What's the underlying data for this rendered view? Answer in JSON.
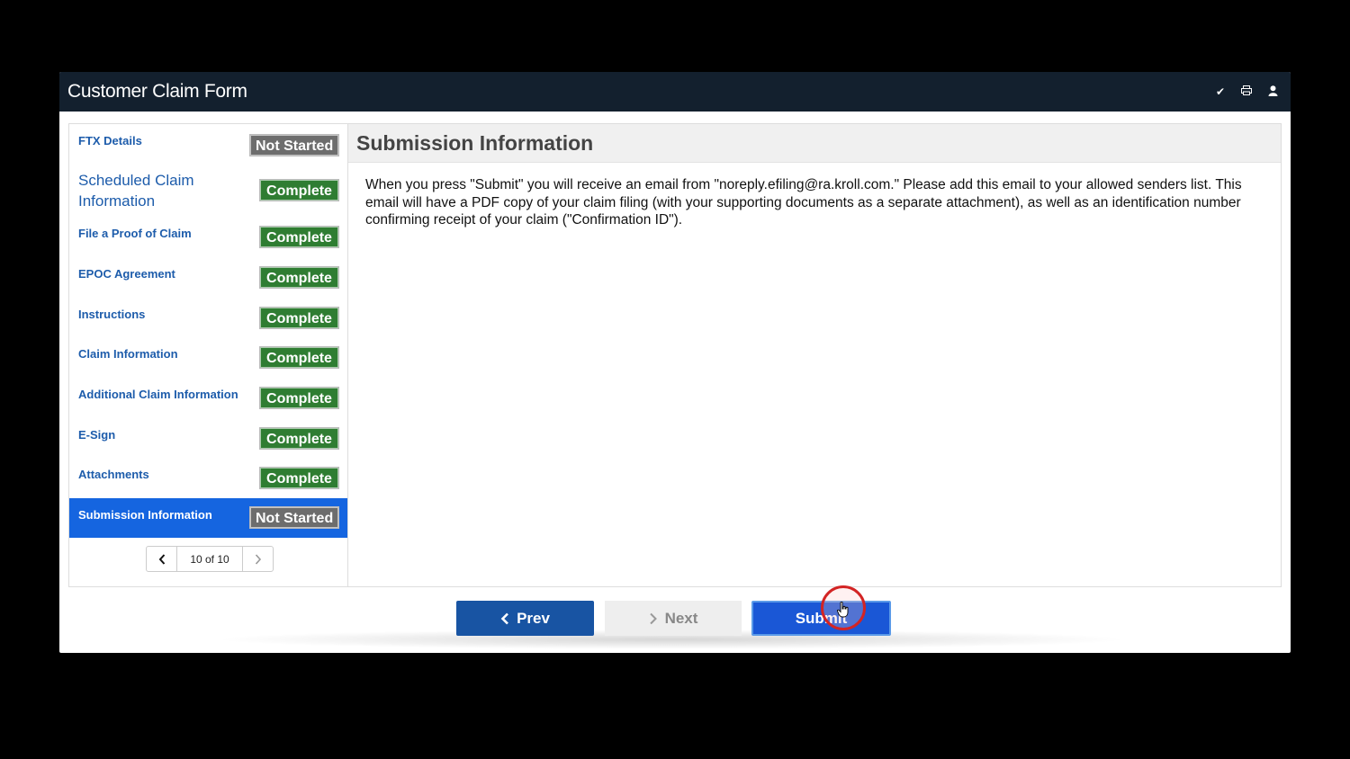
{
  "window": {
    "title": "Customer Claim Form",
    "icons": [
      "check-icon",
      "print-icon",
      "user-icon"
    ]
  },
  "sidebar": {
    "items": [
      {
        "label": "FTX Details",
        "status": "Not Started"
      },
      {
        "label": "Scheduled Claim Information",
        "status": "Complete"
      },
      {
        "label": "File a Proof of Claim",
        "status": "Complete"
      },
      {
        "label": "EPOC Agreement",
        "status": "Complete"
      },
      {
        "label": "Instructions",
        "status": "Complete"
      },
      {
        "label": "Claim Information",
        "status": "Complete"
      },
      {
        "label": "Additional Claim Information",
        "status": "Complete"
      },
      {
        "label": "E-Sign",
        "status": "Complete"
      },
      {
        "label": "Attachments",
        "status": "Complete"
      },
      {
        "label": "Submission Information",
        "status": "Not Started"
      }
    ],
    "pager": {
      "text": "10 of 10"
    }
  },
  "content": {
    "title": "Submission Information",
    "body": "When you press \"Submit\" you will receive an email from \"noreply.efiling@ra.kroll.com.\" Please add this email to your allowed senders list. This email will have a PDF copy of your claim filing (with your supporting documents as a separate attachment), as well as an identification number confirming receipt of your claim (\"Confirmation ID\")."
  },
  "footer": {
    "prev_label": "Prev",
    "next_label": "Next",
    "submit_label": "Submit"
  },
  "colors": {
    "titlebar": "#13202e",
    "complete": "#2f7d32",
    "not_started": "#6d6d6d",
    "active_item": "#1565e0",
    "link": "#1d5cab",
    "prev_button": "#1854a3",
    "submit_button": "#1a57d6"
  }
}
